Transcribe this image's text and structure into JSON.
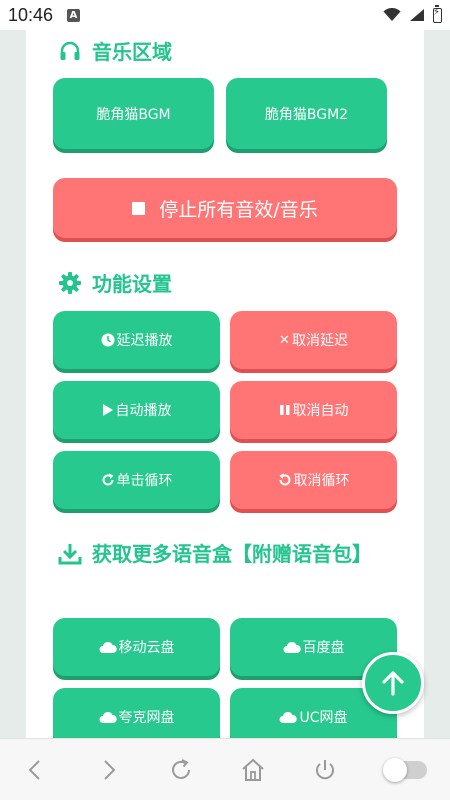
{
  "status_bar": {
    "time": "10:46",
    "notification_icon": "A"
  },
  "colors": {
    "accent_green": "#27c98f",
    "accent_red": "#ff7575",
    "title_green": "#23c48e"
  },
  "music_section": {
    "title": "音乐区域",
    "icon": "headphones-icon",
    "buttons": [
      "脆角猫BGM",
      "脆角猫BGM2"
    ],
    "stop_label": "停止所有音效/音乐"
  },
  "settings_section": {
    "title": "功能设置",
    "icon": "gear-icon",
    "buttons": [
      {
        "label": "延迟播放",
        "icon": "clock-icon",
        "color": "green"
      },
      {
        "label": "取消延迟",
        "icon": "x-icon",
        "color": "red"
      },
      {
        "label": "自动播放",
        "icon": "play-icon",
        "color": "green"
      },
      {
        "label": "取消自动",
        "icon": "pause-icon",
        "color": "red"
      },
      {
        "label": "单击循环",
        "icon": "redo-icon",
        "color": "green"
      },
      {
        "label": "取消循环",
        "icon": "undo-icon",
        "color": "red"
      }
    ]
  },
  "download_section": {
    "title": "获取更多语音盒【附赠语音包】",
    "icon": "download-icon",
    "buttons": [
      "移动云盘",
      "百度盘",
      "夸克网盘",
      "UC网盘"
    ]
  },
  "fab": {
    "icon": "arrow-up-icon"
  },
  "bottom_nav": {
    "items": [
      "back-icon",
      "forward-icon",
      "refresh-icon",
      "home-icon",
      "power-icon",
      "toggle-switch"
    ],
    "toggle_on": false
  }
}
